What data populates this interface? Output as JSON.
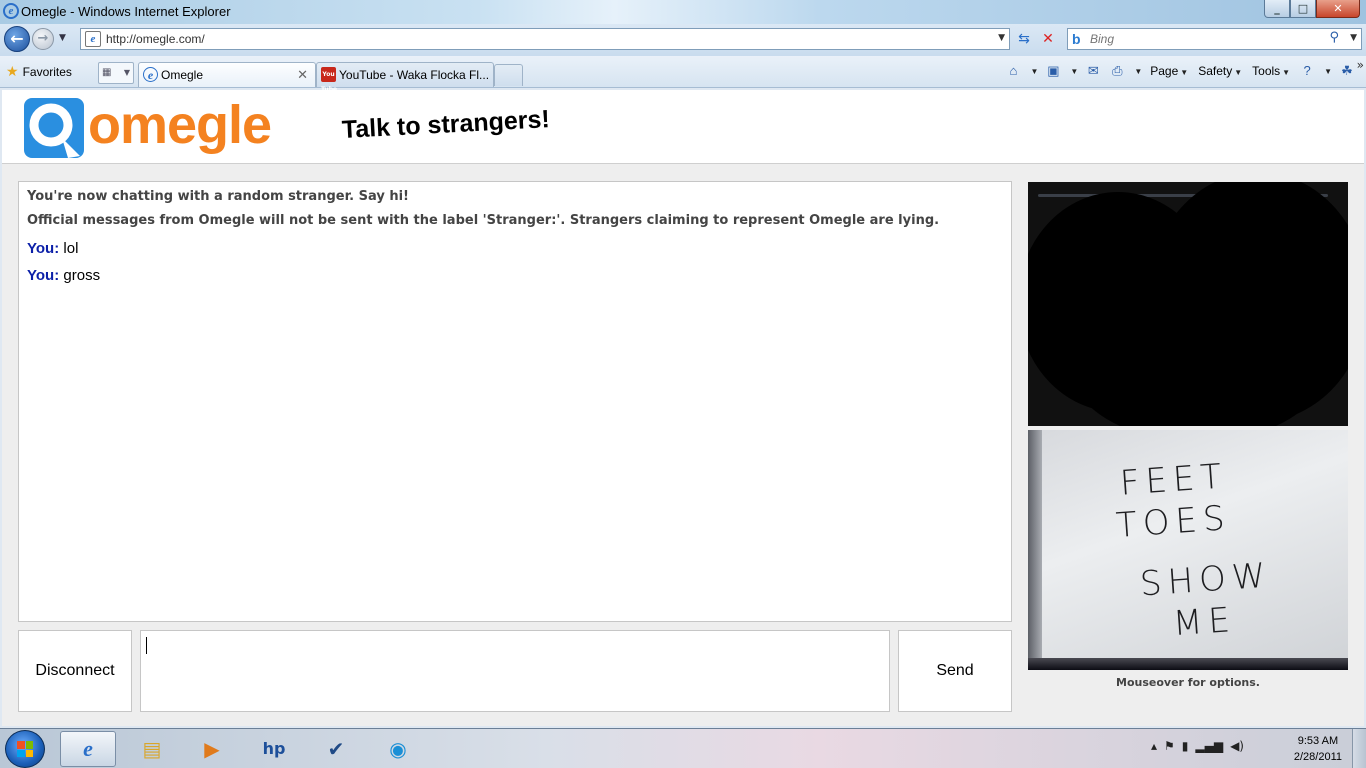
{
  "window": {
    "title": "Omegle - Windows Internet Explorer",
    "min": "_",
    "max": "□",
    "close": "✕"
  },
  "nav": {
    "back": "←",
    "forward": "→",
    "url": "http://omegle.com/",
    "search_placeholder": "Bing",
    "search_brand": "b"
  },
  "tabs": {
    "favorites": "Favorites",
    "items": [
      {
        "label": "Omegle",
        "close": "✕"
      },
      {
        "label": "YouTube - Waka Flocka Fl...",
        "favicon": "You Tube"
      }
    ]
  },
  "commands": {
    "page": "Page",
    "safety": "Safety",
    "tools": "Tools"
  },
  "site": {
    "logo": "omegle",
    "tagline": "Talk to strangers!"
  },
  "chat": {
    "system": [
      "You're now chatting with a random stranger. Say hi!",
      "Official messages from Omegle will not be sent with the label 'Stranger:'. Strangers claiming to represent Omegle are lying."
    ],
    "messages": [
      {
        "sender": "You:",
        "text": "lol"
      },
      {
        "sender": "You:",
        "text": "gross"
      }
    ],
    "disconnect_label": "Disconnect",
    "send_label": "Send",
    "input_value": ""
  },
  "video": {
    "sign_lines": [
      "FEET",
      "TOES",
      "SHOW",
      "ME"
    ],
    "hint": "Mouseover for options."
  },
  "taskbar": {
    "time": "9:53 AM",
    "date": "2/28/2011"
  },
  "colors": {
    "brand_orange": "#f48220",
    "you_blue": "#0b1fa8",
    "logo_blue": "#2a8fe0"
  }
}
